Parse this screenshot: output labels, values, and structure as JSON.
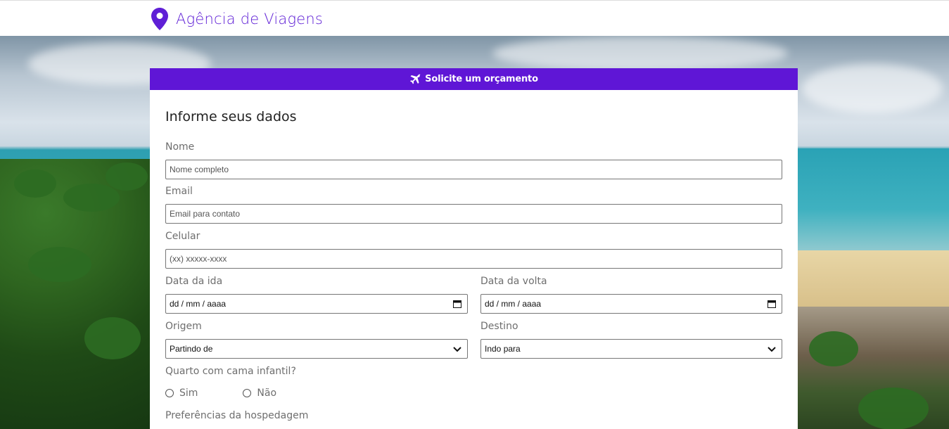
{
  "brand": {
    "name": "Agência de Viagens",
    "icon": "map-pin-icon",
    "color": "#5f1fd6"
  },
  "card": {
    "header": {
      "label": "Solicite um orçamento",
      "icon": "plane-icon",
      "color": "#5f16d6"
    },
    "title": "Informe seus dados",
    "fields": {
      "nome": {
        "label": "Nome",
        "placeholder": "Nome completo"
      },
      "email": {
        "label": "Email",
        "placeholder": "Email para contato"
      },
      "celular": {
        "label": "Celular",
        "placeholder": "(xx) xxxxx-xxxx"
      },
      "data_ida": {
        "label": "Data da ida",
        "value": "dd / mm / aaaa"
      },
      "data_volta": {
        "label": "Data da volta",
        "value": "dd / mm / aaaa"
      },
      "origem": {
        "label": "Origem",
        "selected": "Partindo de"
      },
      "destino": {
        "label": "Destino",
        "selected": "Indo para"
      }
    },
    "quarto": {
      "label": "Quarto com cama infantil?",
      "options": [
        "Sim",
        "Não"
      ]
    },
    "preferencias": {
      "label": "Preferências da hospedagem"
    }
  }
}
